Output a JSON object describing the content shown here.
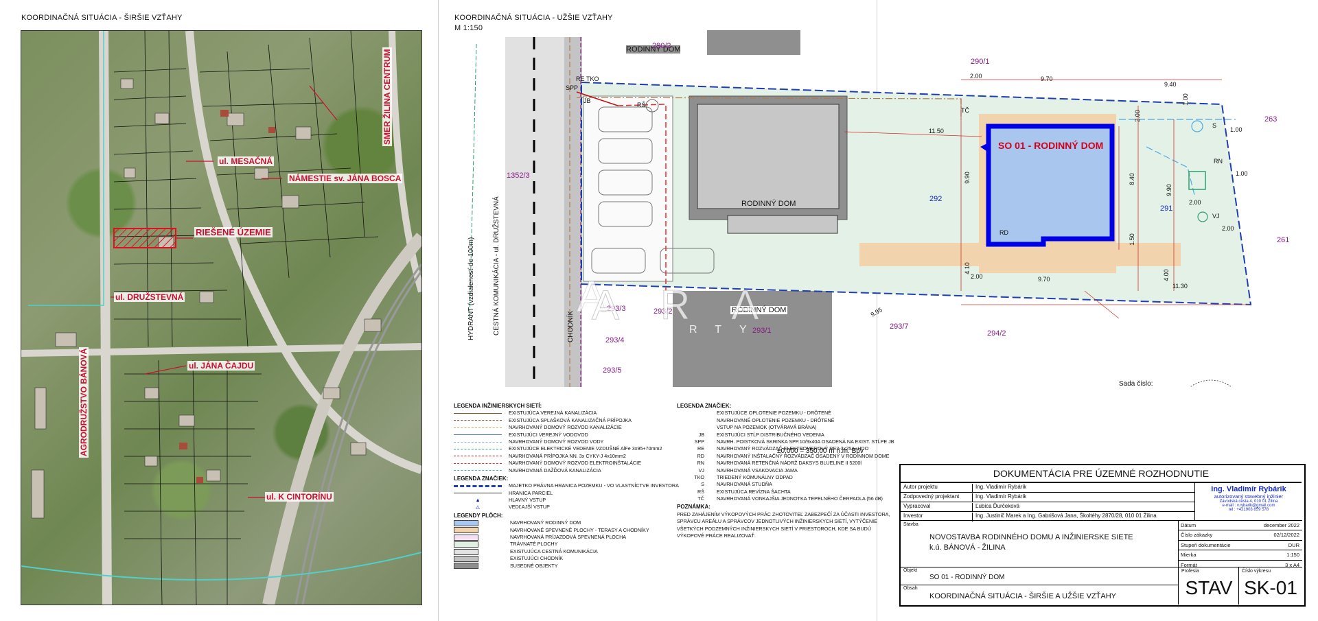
{
  "left_panel": {
    "title": "KOORDINAČNÁ SITUÁCIA - ŠIRŠIE VZŤAHY",
    "labels": {
      "smer": "SMER ŽILINA CENTRUM",
      "mesacna": "ul. MESAČNÁ",
      "namestie": "NÁMESTIE sv. JÁNA BOSCA",
      "riesene": "RIEŠENÉ ÚZEMIE",
      "druzstevna": "ul. DRUŽSTEVNÁ",
      "cajdu": "ul. JÁNA ČAJDU",
      "cintorinu": "ul. K CINTORÍNU",
      "agro": "AGRODRUŽSTVO BÁNOVÁ"
    }
  },
  "right_panel": {
    "title": "KOORDINAČNÁ SITUÁCIA - UŽŠIE VZŤAHY",
    "scale": "M 1:150",
    "labels": {
      "rd_top": "RODINNÝ DOM",
      "rd_mid": "RODINNÝ DOM",
      "rd_bot": "RODINNÝ DOM",
      "so01": "SO 01 - RODINNÝ DOM",
      "road": "CESTNÁ KOMUNIKÁCIA - ul. DRUŽSTEVNÁ",
      "chodnik": "CHODNÍK",
      "hydrant": "HYDRANT (vzdialenosť do 100m)",
      "re": "RE",
      "tko": "TKO",
      "spp": "SPP",
      "jb": "JB",
      "rs": "RŠ",
      "tc": "TČ",
      "s": "S",
      "rn": "RN",
      "vj": "VJ",
      "rd": "RD",
      "height": "±0,000 = 350,00 m n.m. Bpv",
      "sada": "Sada číslo:"
    },
    "parcels": {
      "p290_2": "290/2",
      "p290_1": "290/1",
      "p263": "263",
      "p1352_3": "1352/3",
      "p292": "292",
      "p291": "291",
      "p261": "261",
      "p293_3": "293/3",
      "p293_2": "293/2",
      "p293_1": "293/1",
      "p293_7": "293/7",
      "p294_2": "294/2",
      "p293_4": "293/4",
      "p293_5": "293/5"
    },
    "dims": {
      "d200a": "2.00",
      "d970a": "9.70",
      "d940": "9.40",
      "d100a": "1.00",
      "d100b": "1.00",
      "d100c": "1.00",
      "d200b": "2.00",
      "d1150": "11.50",
      "d990a": "9.90",
      "d840": "8.40",
      "d990b": "9.90",
      "d150": "1.50",
      "d400": "4.00",
      "d410": "4.10",
      "d200c": "2.00",
      "d970b": "9.70",
      "d1130": "11.30",
      "d995": "9.95",
      "d200d": "2.00",
      "d200e": "2.00"
    },
    "watermark": [
      "A",
      "R",
      "A",
      "R",
      "T",
      "Y"
    ]
  },
  "legend_networks": {
    "title": "LEGENDA INŽINIERSKYCH SIETÍ:",
    "items": [
      "EXISTUJÚCA VEREJNÁ KANALIZÁCIA",
      "EXISTUJÚCA SPLAŠKOVÁ KANALIZAČNÁ PRÍPOJKA",
      "NAVRHOVANÝ DOMOVÝ ROZVOD KANALIZÁCIE",
      "EXISTUJÚCI VEREJNÝ VODOVOD",
      "NAVRHOVANÝ DOMOVÝ ROZVOD VODY",
      "EXISTUJÚCE ELEKTRICKÉ VEDENIE VZDUŠNÉ AlFe 3x95+70mm2",
      "NAVRHOVANÁ PRÍPOJKA NN. 3x CYKY-J 4x10mm2",
      "NAVRHOVANÝ DOMOVÝ ROZVOD ELEKTROINŠTALÁCIE",
      "NAVRHOVANÁ DAŽĎOVÁ KANALIZÁCIA"
    ],
    "colors": [
      "#8b5a2b",
      "#8b5a2b",
      "#d2a060",
      "#4a7fd0",
      "#86b7ee",
      "#2f9f6f",
      "#c01010",
      "#e03030",
      "#4da8e6"
    ]
  },
  "legend_marks": {
    "title": "LEGENDA ZNAČIEK:",
    "items": [
      "MAJETKO PRÁVNA HRANICA POZEMKU - VO VLASTNÍCTVE INVESTORA",
      "HRANICA PARCIEL",
      "HLAVNÝ VSTUP",
      "VEDĽAJŠÍ VSTUP"
    ]
  },
  "legend_areas": {
    "title": "LEGENDY PLÔCH:",
    "items": [
      "NAVRHOVANÝ RODINNÝ DOM",
      "NAVRHOVANÉ SPEVNENÉ PLOCHY - TERASY A CHODNÍKY",
      "NAVRHOVANÁ PRÍJAZDOVÁ SPEVNENÁ PLOCHA",
      "TRÁVNATÉ PLOCHY",
      "EXISTUJÚCA CESTNÁ KOMUNIKÁCIA",
      "EXISTUJÚCI CHODNÍK",
      "SUSEDNÉ OBJEKTY"
    ],
    "colors": [
      "#a9c6ee",
      "#f1d3ae",
      "#f4dff3",
      "#dff0e2",
      "#e3e3e3",
      "#c2c2c2",
      "#8f8f8f"
    ]
  },
  "legend_signs": {
    "title": "LEGENDA ZNAČIEK:",
    "items": [
      {
        "code": "",
        "text": "EXISTUJÚCE OPLOTENIE POZEMKU - DRÔTENÉ"
      },
      {
        "code": "",
        "text": "NAVRHOVANÉ OPLOTENIE POZEMKU - DRÔTENÉ"
      },
      {
        "code": "",
        "text": "VSTUP NA POZEMOK (OTVÁRAVÁ BRÁNA)"
      },
      {
        "code": "JB",
        "text": "EXISTUJÚCI STĹP DISTRIBUČNÉHO VEDENIA"
      },
      {
        "code": "SPP",
        "text": "NAVRH. POISTKOVÁ SKRINKA SPP.10/9x40A OSADENÁ NA EXIST. STĹPE JB"
      },
      {
        "code": "RE",
        "text": "NAVRHOVANÝ ROZVÁDZAČ ELEKTROMEROVÝ RE3-3x25A+HDO"
      },
      {
        "code": "RD",
        "text": "NAVRHOVANÝ INŠTALAČNÝ ROZVÁDZAČ OSADENÝ V RODINNOM DOME"
      },
      {
        "code": "RN",
        "text": "NAVRHOVANÁ RETENČNÁ NÁDRŽ DAKSYS BLUELINE II 5200l"
      },
      {
        "code": "VJ",
        "text": "NAVRHOVANÁ VSAKOVACIA JAMA"
      },
      {
        "code": "TKO",
        "text": "TRIEDENÝ KOMUNÁLNY ODPAD"
      },
      {
        "code": "S",
        "text": "NAVRHOVANÁ STUDŇA"
      },
      {
        "code": "RŠ",
        "text": "EXISTUJÚCA REVÍZNA ŠACHTA"
      },
      {
        "code": "TČ",
        "text": "NAVRHOVANÁ VONKAJŠIA JEDNOTKA TEPELNÉHO ČERPADLA (56 dB)"
      }
    ],
    "note_title": "POZNÁMKA:",
    "note_lines": [
      "PRED ZAHÁJENÍM VÝKOPOVÝCH PRÁC ZHOTOVITEĽ ZABEZPEČÍ ZA ÚČASTI INVESTORA,",
      "SPRÁVCU AREÁLU A SPRÁVCOV JEDNOTLIVÝCH INŽINIERSKYCH SIETÍ, VYTÝČENIE",
      "VŠETKÝCH PODZEMNÝCH INŽINIERSKYCH SIETÍ V PRIESTOROCH, KDE SA BUDÚ",
      "VÝKOPOVÉ PRÁCE REALIZOVAŤ."
    ]
  },
  "title_block": {
    "heading": "DOKUMENTÁCIA PRE ÚZEMNÉ ROZHODNUTIE",
    "rows": [
      {
        "label": "Autor projektu",
        "value": "Ing. Vladimír Rybárik"
      },
      {
        "label": "Zodpovedný projektant",
        "value": "Ing. Vladimír Rybárik"
      },
      {
        "label": "Vypracoval",
        "value": "Ľubica Ďurčeková"
      },
      {
        "label": "Investor",
        "value": "Ing. Justinič Marek a Ing. Gabrišová Jana, Školtéhy 2870/28, 010 01 Žilina"
      }
    ],
    "firm_name": "Ing. Vladimír Rybárik",
    "firm_role": "autorizovaný stavebný inžinier",
    "firm_addr": "Závodská cesta 4, 010 01 Žilina",
    "firm_email": "e-mail : v.rybarik@gmail.com",
    "firm_tel": "tel : +421903 859 578",
    "stavba_label": "Stavba",
    "stavba_line1": "NOVOSTAVBA RODINNÉHO DOMU A INŽINIERSKE SIETE",
    "stavba_line2": "k.ú. BÁNOVÁ - ŽILINA",
    "info": [
      {
        "label": "Dátum",
        "value": "december 2022"
      },
      {
        "label": "Číslo zákazky",
        "value": "02/12/2022"
      },
      {
        "label": "Stupeň dokumentácie",
        "value": "DUR"
      },
      {
        "label": "Mierka",
        "value": "1:150"
      },
      {
        "label": "Formát",
        "value": "3 x A4"
      }
    ],
    "objekt_label": "Objekt",
    "objekt_value": "SO 01 - RODINNÝ DOM",
    "obsah_label": "Obsah",
    "obsah_value": "KOORDINAČNÁ SITUÁCIA - ŠIRŠIE A UŽŠIE VZŤAHY",
    "profesia_label": "Profesia",
    "profesia_value": "STAV",
    "cislo_label": "Číslo výkresu",
    "cislo_value": "SK-01"
  }
}
